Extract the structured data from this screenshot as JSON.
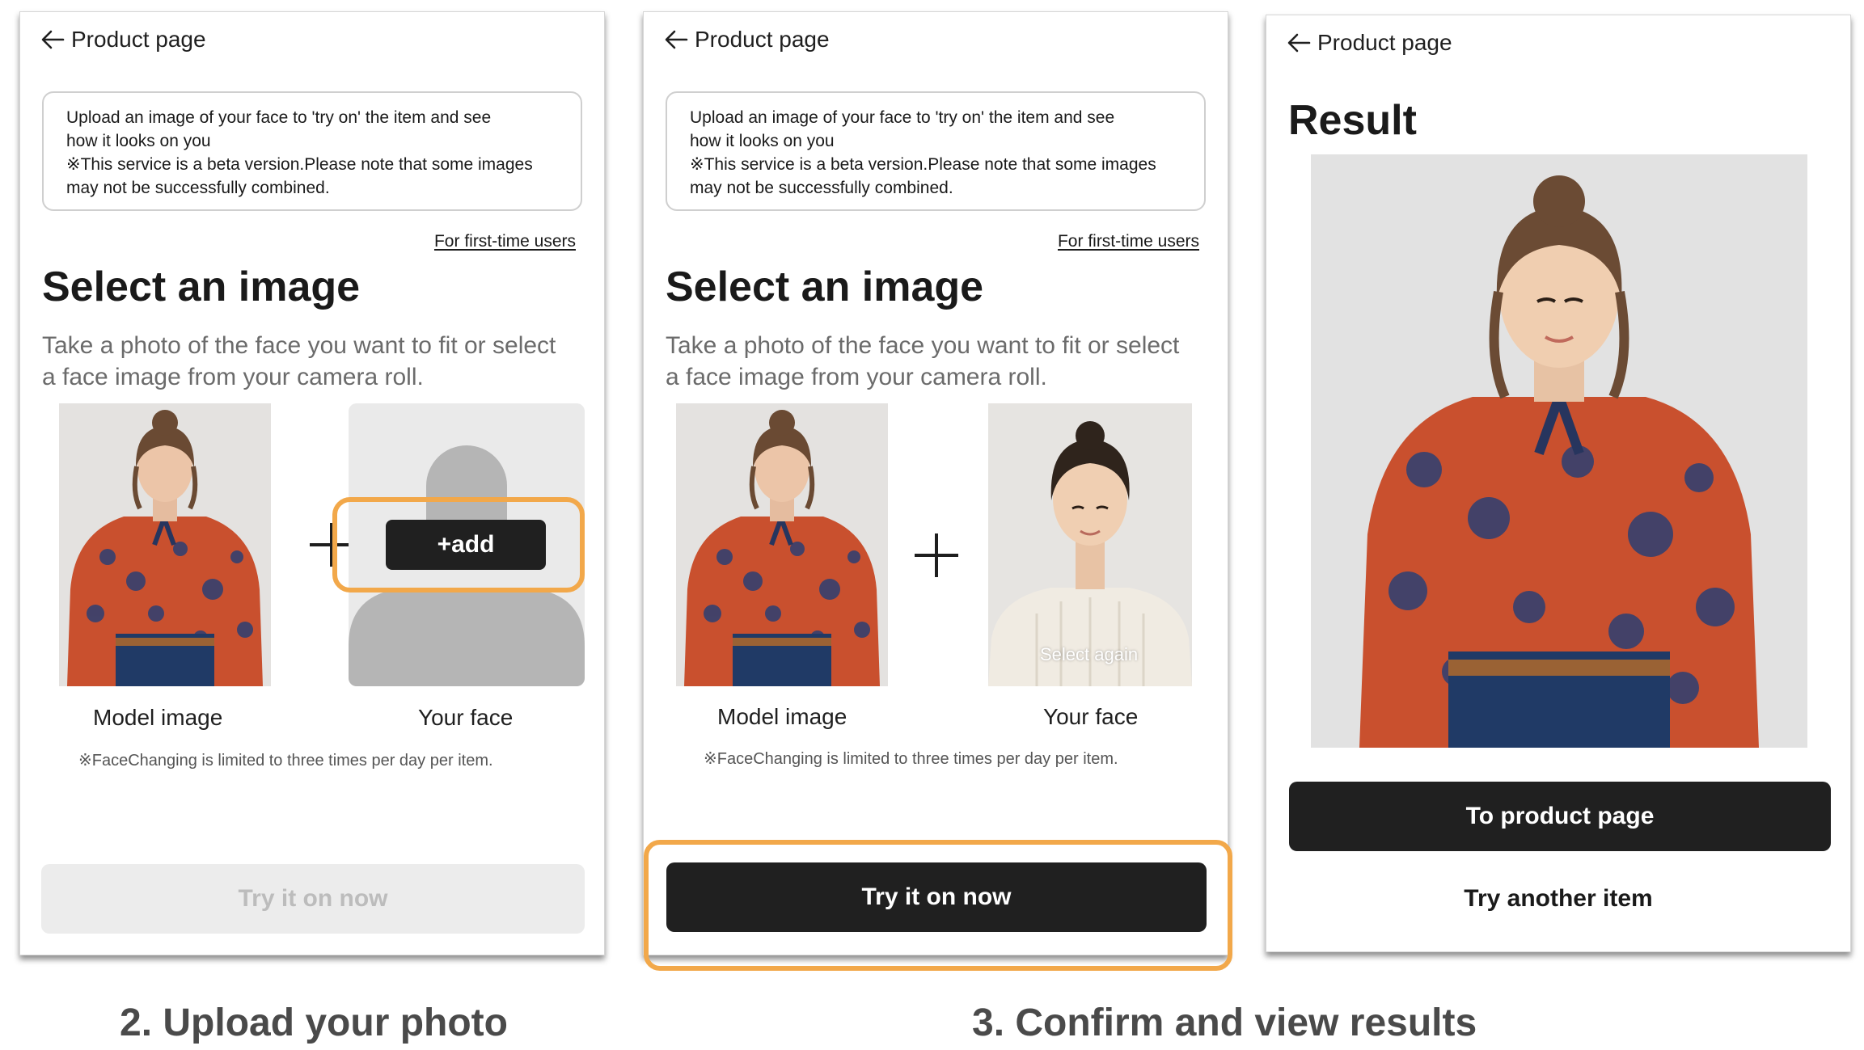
{
  "nav": {
    "back_label": "Product page"
  },
  "notice": {
    "line1": "Upload an image of your face to 'try on' the item and see",
    "line2": "how it looks on you",
    "line3": "※This service is a beta version.Please note that some images",
    "line4": "may not be successfully combined."
  },
  "first_time_link": "For first-time users",
  "select_title": "Select an image",
  "instructions": {
    "line1": "Take a photo of the face you want to fit or select",
    "line2": "a face image from your camera roll."
  },
  "captions": {
    "model": "Model image",
    "face": "Your face"
  },
  "limit_note": "※FaceChanging is limited to three times per day per item.",
  "add_button": "+add",
  "select_again": "Select again",
  "try_button": "Try it on now",
  "result": {
    "title": "Result",
    "to_product_button": "To product page",
    "try_another_link": "Try another item"
  },
  "steps": {
    "upload": "2. Upload your photo",
    "confirm": "3. Confirm and view results"
  },
  "colors": {
    "accent_orange": "#f2a84a",
    "button_dark": "#202020",
    "button_disabled": "#ececec",
    "placeholder_gray": "#b3b3b3"
  }
}
